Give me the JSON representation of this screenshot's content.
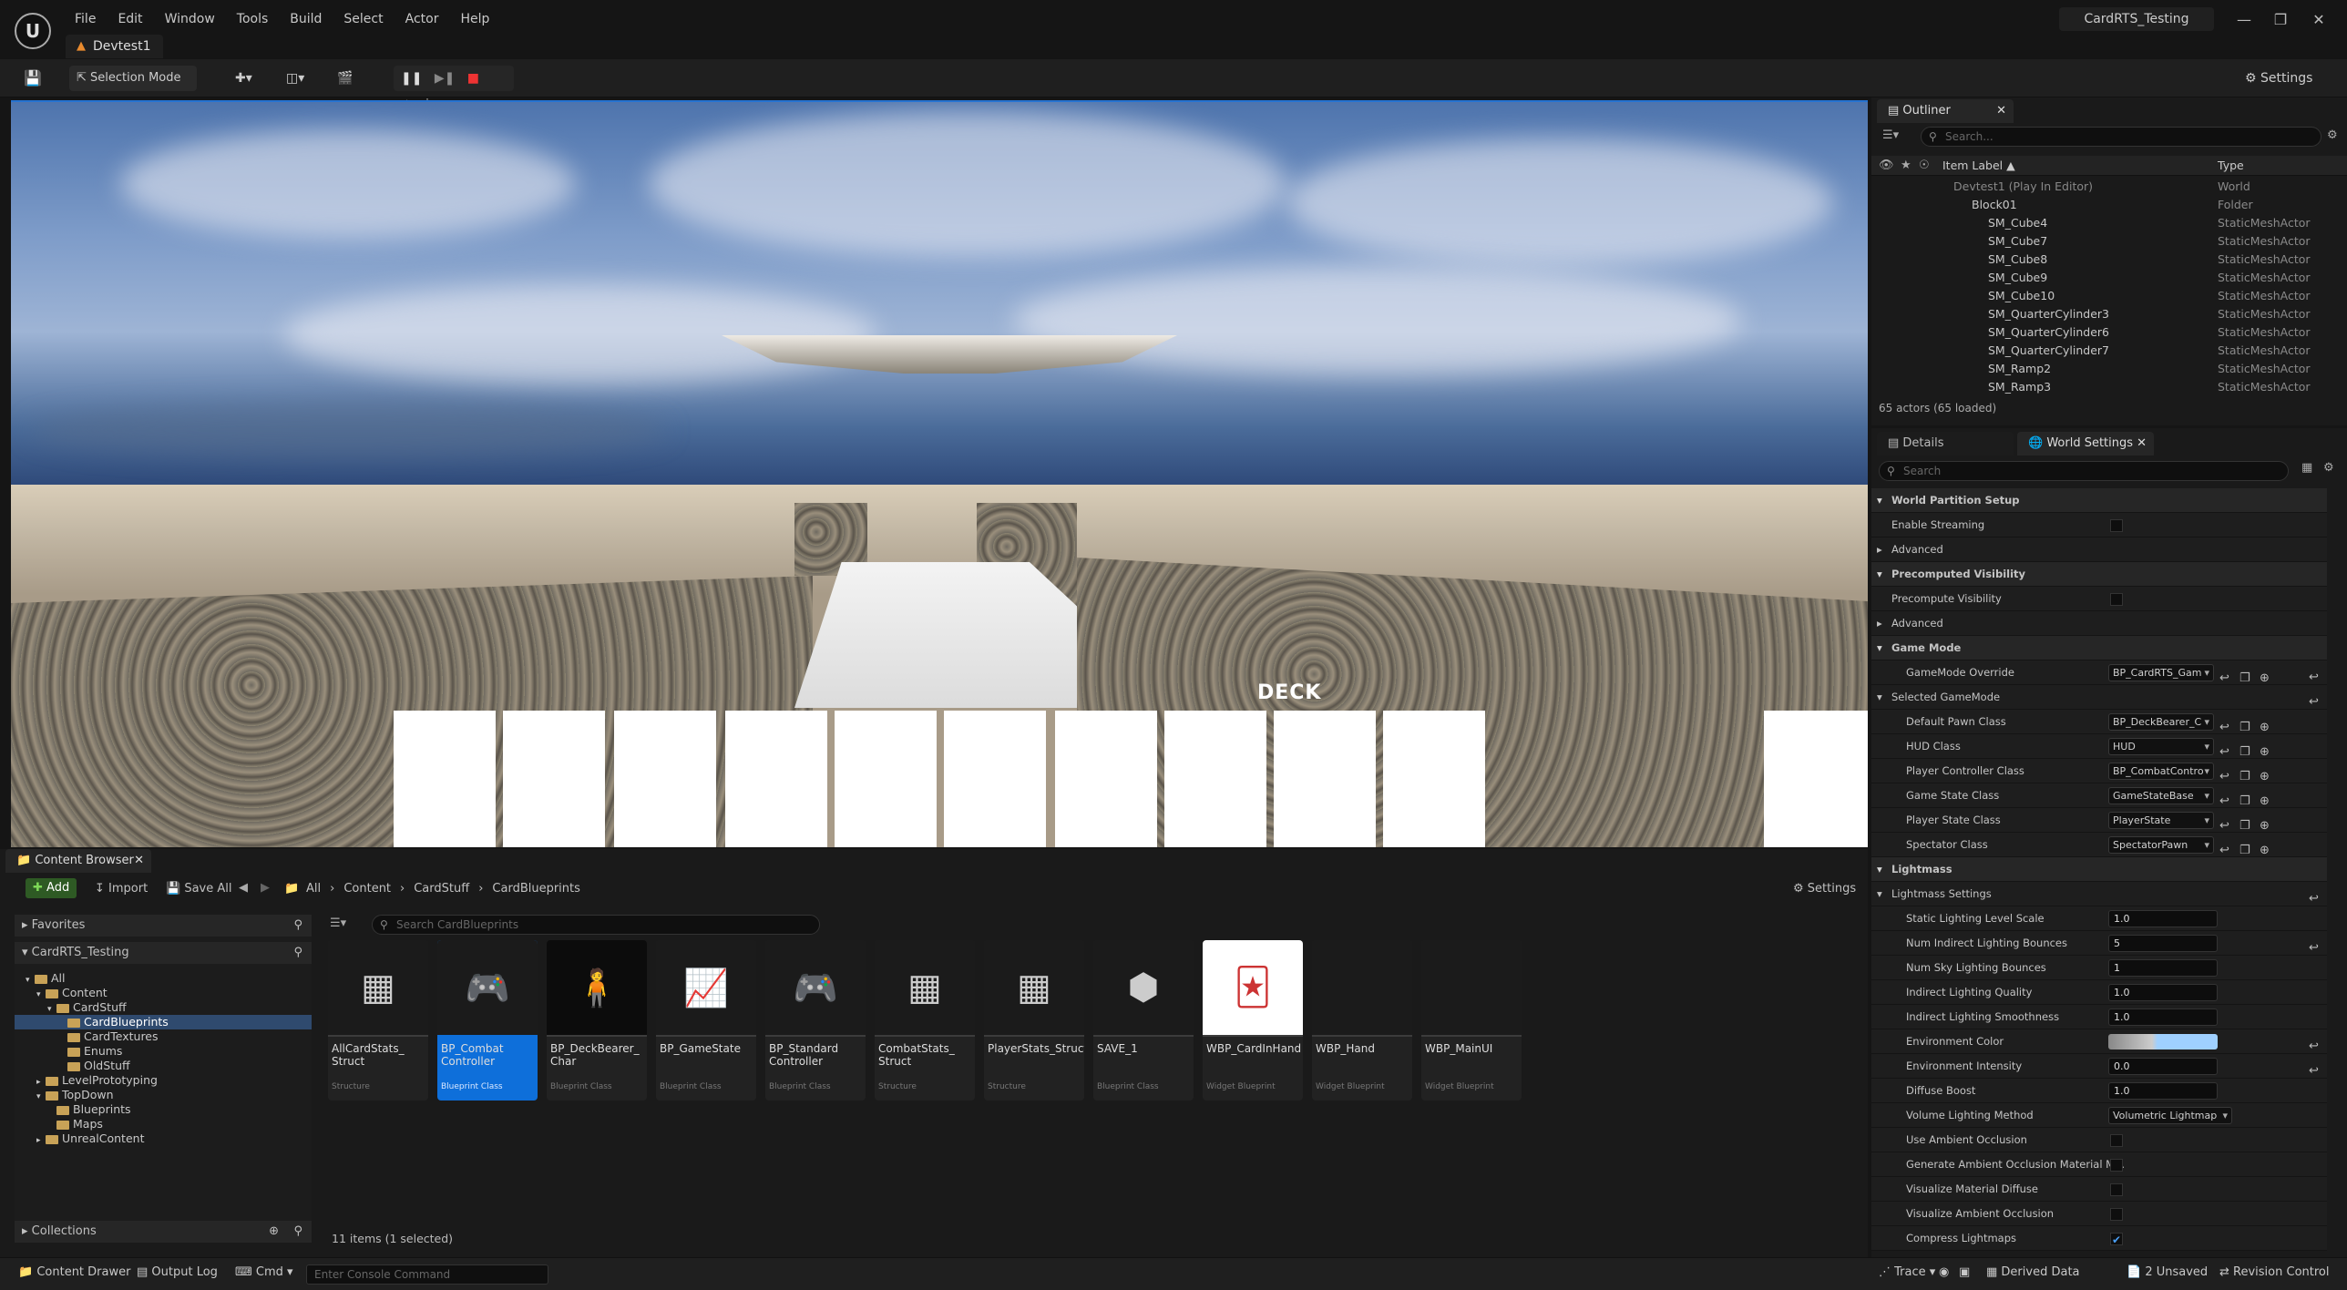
{
  "menu": [
    "File",
    "Edit",
    "Window",
    "Tools",
    "Build",
    "Select",
    "Actor",
    "Help"
  ],
  "level_tab": "Devtest1",
  "project_name": "CardRTS_Testing",
  "toolbar": {
    "selection_mode": "Selection Mode",
    "settings": "Settings"
  },
  "viewport": {
    "deck_label": "DECK"
  },
  "outliner": {
    "tab": "Outliner",
    "search_placeholder": "Search...",
    "col_label": "Item Label",
    "col_type": "Type",
    "rows": [
      {
        "label": "Devtest1 (Play In Editor)",
        "type": "World"
      },
      {
        "label": "Block01",
        "type": "Folder"
      },
      {
        "label": "SM_Cube4",
        "type": "StaticMeshActor"
      },
      {
        "label": "SM_Cube7",
        "type": "StaticMeshActor"
      },
      {
        "label": "SM_Cube8",
        "type": "StaticMeshActor"
      },
      {
        "label": "SM_Cube9",
        "type": "StaticMeshActor"
      },
      {
        "label": "SM_Cube10",
        "type": "StaticMeshActor"
      },
      {
        "label": "SM_QuarterCylinder3",
        "type": "StaticMeshActor"
      },
      {
        "label": "SM_QuarterCylinder6",
        "type": "StaticMeshActor"
      },
      {
        "label": "SM_QuarterCylinder7",
        "type": "StaticMeshActor"
      },
      {
        "label": "SM_Ramp2",
        "type": "StaticMeshActor"
      },
      {
        "label": "SM_Ramp3",
        "type": "StaticMeshActor"
      }
    ],
    "footer": "65 actors (65 loaded)"
  },
  "details": {
    "tab_details": "Details",
    "tab_world": "World Settings",
    "search_placeholder": "Search",
    "rows": [
      {
        "kind": "section",
        "label": "World Partition Setup"
      },
      {
        "kind": "check",
        "label": "Enable Streaming",
        "checked": false
      },
      {
        "kind": "expand",
        "label": "Advanced"
      },
      {
        "kind": "section",
        "label": "Precomputed Visibility"
      },
      {
        "kind": "check",
        "label": "Precompute Visibility",
        "checked": false
      },
      {
        "kind": "expand",
        "label": "Advanced"
      },
      {
        "kind": "section",
        "label": "Game Mode"
      },
      {
        "kind": "combo",
        "label": "GameMode Override",
        "value": "BP_CardRTS_Gam"
      },
      {
        "kind": "subsection",
        "label": "Selected GameMode"
      },
      {
        "kind": "combo",
        "label": "Default Pawn Class",
        "value": "BP_DeckBearer_C"
      },
      {
        "kind": "combo",
        "label": "HUD Class",
        "value": "HUD"
      },
      {
        "kind": "combo",
        "label": "Player Controller Class",
        "value": "BP_CombatContro"
      },
      {
        "kind": "combo",
        "label": "Game State Class",
        "value": "GameStateBase"
      },
      {
        "kind": "combo",
        "label": "Player State Class",
        "value": "PlayerState"
      },
      {
        "kind": "combo",
        "label": "Spectator Class",
        "value": "SpectatorPawn"
      },
      {
        "kind": "section",
        "label": "Lightmass"
      },
      {
        "kind": "subsection",
        "label": "Lightmass Settings"
      },
      {
        "kind": "num",
        "label": "Static Lighting Level Scale",
        "value": "1.0"
      },
      {
        "kind": "num",
        "label": "Num Indirect Lighting Bounces",
        "value": "5"
      },
      {
        "kind": "num",
        "label": "Num Sky Lighting Bounces",
        "value": "1"
      },
      {
        "kind": "num",
        "label": "Indirect Lighting Quality",
        "value": "1.0"
      },
      {
        "kind": "num",
        "label": "Indirect Lighting Smoothness",
        "value": "1.0"
      },
      {
        "kind": "color",
        "label": "Environment Color"
      },
      {
        "kind": "num",
        "label": "Environment Intensity",
        "value": "0.0"
      },
      {
        "kind": "num",
        "label": "Diffuse Boost",
        "value": "1.0"
      },
      {
        "kind": "combo",
        "label": "Volume Lighting Method",
        "value": "Volumetric Lightmap"
      },
      {
        "kind": "check",
        "label": "Use Ambient Occlusion",
        "checked": false
      },
      {
        "kind": "check",
        "label": "Generate Ambient Occlusion Material M...",
        "checked": false
      },
      {
        "kind": "check",
        "label": "Visualize Material Diffuse",
        "checked": false
      },
      {
        "kind": "check",
        "label": "Visualize Ambient Occlusion",
        "checked": false
      },
      {
        "kind": "check",
        "label": "Compress Lightmaps",
        "checked": true
      }
    ]
  },
  "content_browser": {
    "tab": "Content Browser",
    "add": "Add",
    "import": "Import",
    "save_all": "Save All",
    "breadcrumb": [
      "All",
      "Content",
      "CardStuff",
      "CardBlueprints"
    ],
    "settings": "Settings",
    "search_placeholder": "Search CardBlueprints",
    "favorites": "Favorites",
    "project": "CardRTS_Testing",
    "collections": "Collections",
    "tree": [
      "All",
      "Content",
      "CardStuff",
      "CardBlueprints",
      "CardTextures",
      "Enums",
      "OldStuff",
      "LevelPrototyping",
      "TopDown",
      "Blueprints",
      "Maps",
      "UnrealContent"
    ],
    "status": "11 items (1 selected)",
    "assets": [
      {
        "name": "AllCardStats_ Struct",
        "kind": "Structure",
        "icon": "struct-icon"
      },
      {
        "name": "BP_Combat Controller",
        "kind": "Blueprint Class",
        "icon": "gamepad-icon"
      },
      {
        "name": "BP_DeckBearer_ Char",
        "kind": "Blueprint Class",
        "icon": "character-icon"
      },
      {
        "name": "BP_GameState",
        "kind": "Blueprint Class",
        "icon": "chart-icon"
      },
      {
        "name": "BP_Standard Controller",
        "kind": "Blueprint Class",
        "icon": "gamepad-icon"
      },
      {
        "name": "CombatStats_ Struct",
        "kind": "Structure",
        "icon": "struct-icon"
      },
      {
        "name": "PlayerStats_Struct",
        "kind": "Structure",
        "icon": "struct-icon"
      },
      {
        "name": "SAVE_1",
        "kind": "Blueprint Class",
        "icon": "cube-icon"
      },
      {
        "name": "WBP_CardInHand",
        "kind": "Widget Blueprint",
        "icon": "card-icon"
      },
      {
        "name": "WBP_Hand",
        "kind": "Widget Blueprint",
        "icon": "widget-icon"
      },
      {
        "name": "WBP_MainUI",
        "kind": "Widget Blueprint",
        "icon": "widget-icon"
      }
    ]
  },
  "statusbar": {
    "content_drawer": "Content Drawer",
    "output_log": "Output Log",
    "cmd": "Cmd",
    "console_placeholder": "Enter Console Command",
    "trace": "Trace",
    "derived_data": "Derived Data",
    "unsaved": "2 Unsaved",
    "revision_control": "Revision Control"
  }
}
